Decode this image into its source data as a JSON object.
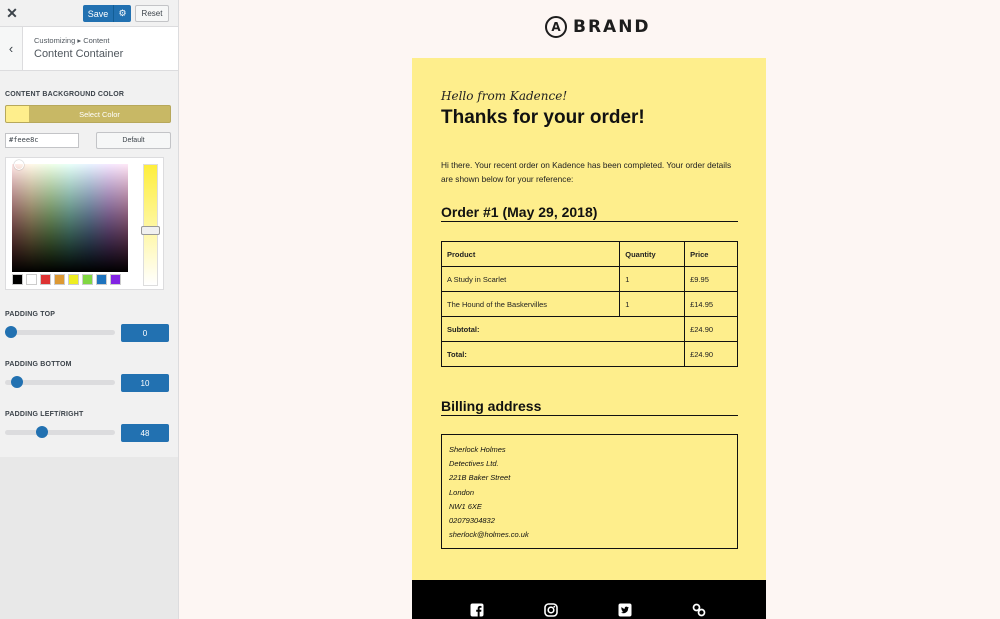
{
  "sidebar": {
    "close_glyph": "✕",
    "save_label": "Save",
    "gear_glyph": "⚙",
    "reset_label": "Reset",
    "back_glyph": "‹",
    "breadcrumb": "Customizing ▸ Content",
    "section_title": "Content Container",
    "bg_color_label": "CONTENT BACKGROUND COLOR",
    "select_color_label": "Select Color",
    "hex_value": "#feee8c",
    "default_label": "Default",
    "palette_colors": [
      "#000000",
      "#ffffff",
      "#dd3333",
      "#dd9933",
      "#eeee22",
      "#81d742",
      "#1e73be",
      "#8224e3"
    ],
    "padding_top_label": "PADDING TOP",
    "padding_top_value": "0",
    "padding_bottom_label": "PADDING BOTTOM",
    "padding_bottom_value": "10",
    "padding_lr_label": "PADDING LEFT/RIGHT",
    "padding_lr_value": "48"
  },
  "brand": {
    "logo_letter": "A",
    "name": "BRAND"
  },
  "email": {
    "greeting": "Hello from Kadence!",
    "heading": "Thanks for your order!",
    "intro": "Hi there. Your recent order on Kadence has been completed. Your order details are shown below for your reference:",
    "order_heading": "Order #1 (May 29, 2018)",
    "table": {
      "headers": [
        "Product",
        "Quantity",
        "Price"
      ],
      "rows": [
        [
          "A Study in Scarlet",
          "1",
          "£9.95"
        ],
        [
          "The Hound of the Baskervilles",
          "1",
          "£14.95"
        ]
      ],
      "subtotal_label": "Subtotal:",
      "subtotal_value": "£24.90",
      "total_label": "Total:",
      "total_value": "£24.90"
    },
    "billing_heading": "Billing address",
    "address": [
      "Sherlock Holmes",
      "Detectives Ltd.",
      "221B Baker Street",
      "London",
      "NW1 6XE",
      "02079304832",
      "sherlock@holmes.co.uk"
    ]
  },
  "colors": {
    "accent": "#2271b1",
    "email_bg": "#feee8c",
    "footer_bg": "#000000"
  },
  "footer_icons": [
    "facebook-icon",
    "instagram-icon",
    "twitter-icon",
    "link-icon"
  ]
}
